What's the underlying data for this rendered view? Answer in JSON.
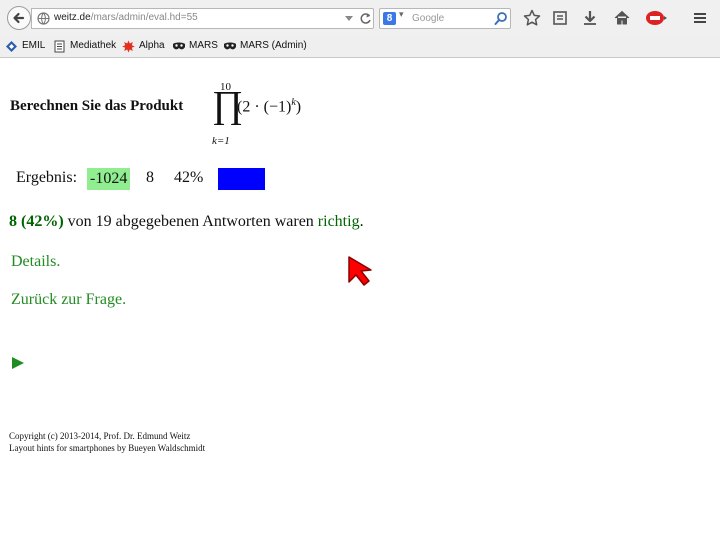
{
  "browser": {
    "url_host": "weitz.de",
    "url_path": "/mars/admin/eval.hd=55",
    "search_placeholder": "Google",
    "search_engine_letter": "8"
  },
  "bookmarks": [
    {
      "label": "EMIL"
    },
    {
      "label": "Mediathek"
    },
    {
      "label": "Alpha"
    },
    {
      "label": "MARS"
    },
    {
      "label": "MARS (Admin)"
    }
  ],
  "question": {
    "title": "Berechnen Sie das Produkt",
    "product_upper": "10",
    "product_lower": "k=1",
    "product_body": "(2 · (−1)",
    "product_exponent": "k",
    "product_close": ")"
  },
  "result": {
    "label": "Ergebnis:",
    "value": "-1024",
    "count": "8",
    "percent": "42%",
    "bar_color": "#0000ff",
    "fraction_correct": 0.42
  },
  "summary": {
    "bold_part": "8 (42%)",
    "middle_part": " von 19 abgegebenen Antworten waren ",
    "green_part": "richtig",
    "end_part": "."
  },
  "links": {
    "details": "Details.",
    "back": "Zurück zur Frage."
  },
  "footer": {
    "line1": "Copyright (c) 2013-2014, Prof. Dr. Edmund Weitz",
    "line2": "Layout hints for smartphones by Bueyen Waldschmidt"
  },
  "colors": {
    "correct_highlight": "#90ee90",
    "link_green": "#228b22",
    "accent_blue": "#0000ff",
    "cursor_red": "#ff0000"
  }
}
